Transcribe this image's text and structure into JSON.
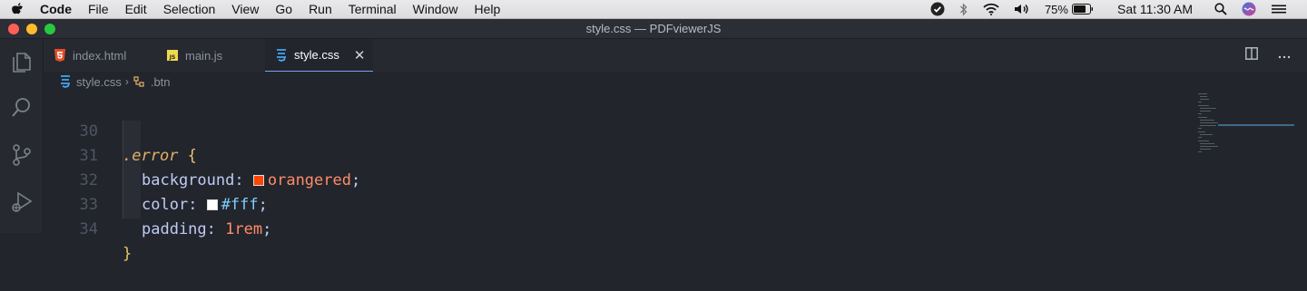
{
  "menubar": {
    "app": "Code",
    "items": [
      "File",
      "Edit",
      "Selection",
      "View",
      "Go",
      "Run",
      "Terminal",
      "Window",
      "Help"
    ],
    "battery": "75%",
    "clock": "Sat 11:30 AM"
  },
  "window": {
    "title": "style.css — PDFviewerJS"
  },
  "tabs": [
    {
      "label": "index.html",
      "icon": "html5-icon",
      "color": "#e44d26"
    },
    {
      "label": "main.js",
      "icon": "js-icon",
      "color": "#f0d94e"
    },
    {
      "label": "style.css",
      "icon": "css3-icon",
      "color": "#42a5f5",
      "active": true
    }
  ],
  "breadcrumb": {
    "file": "style.css",
    "symbol": ".btn"
  },
  "editor": {
    "lines": [
      {
        "num": "30",
        "selector": ".error",
        "brace": "{"
      },
      {
        "num": "31",
        "prop": "background",
        "colon": ":",
        "value": "orangered",
        "semi": ";",
        "swatch": "#ff4500"
      },
      {
        "num": "32",
        "prop": "color",
        "colon": ":",
        "value": "#fff",
        "semi": ";",
        "swatch": "#ffffff"
      },
      {
        "num": "33",
        "prop": "padding",
        "colon": ":",
        "value": "1rem",
        "semi": ";"
      },
      {
        "num": "34",
        "brace": "}"
      }
    ]
  },
  "colors": {
    "accent": "#7aa2f7",
    "background": "#22252c"
  }
}
